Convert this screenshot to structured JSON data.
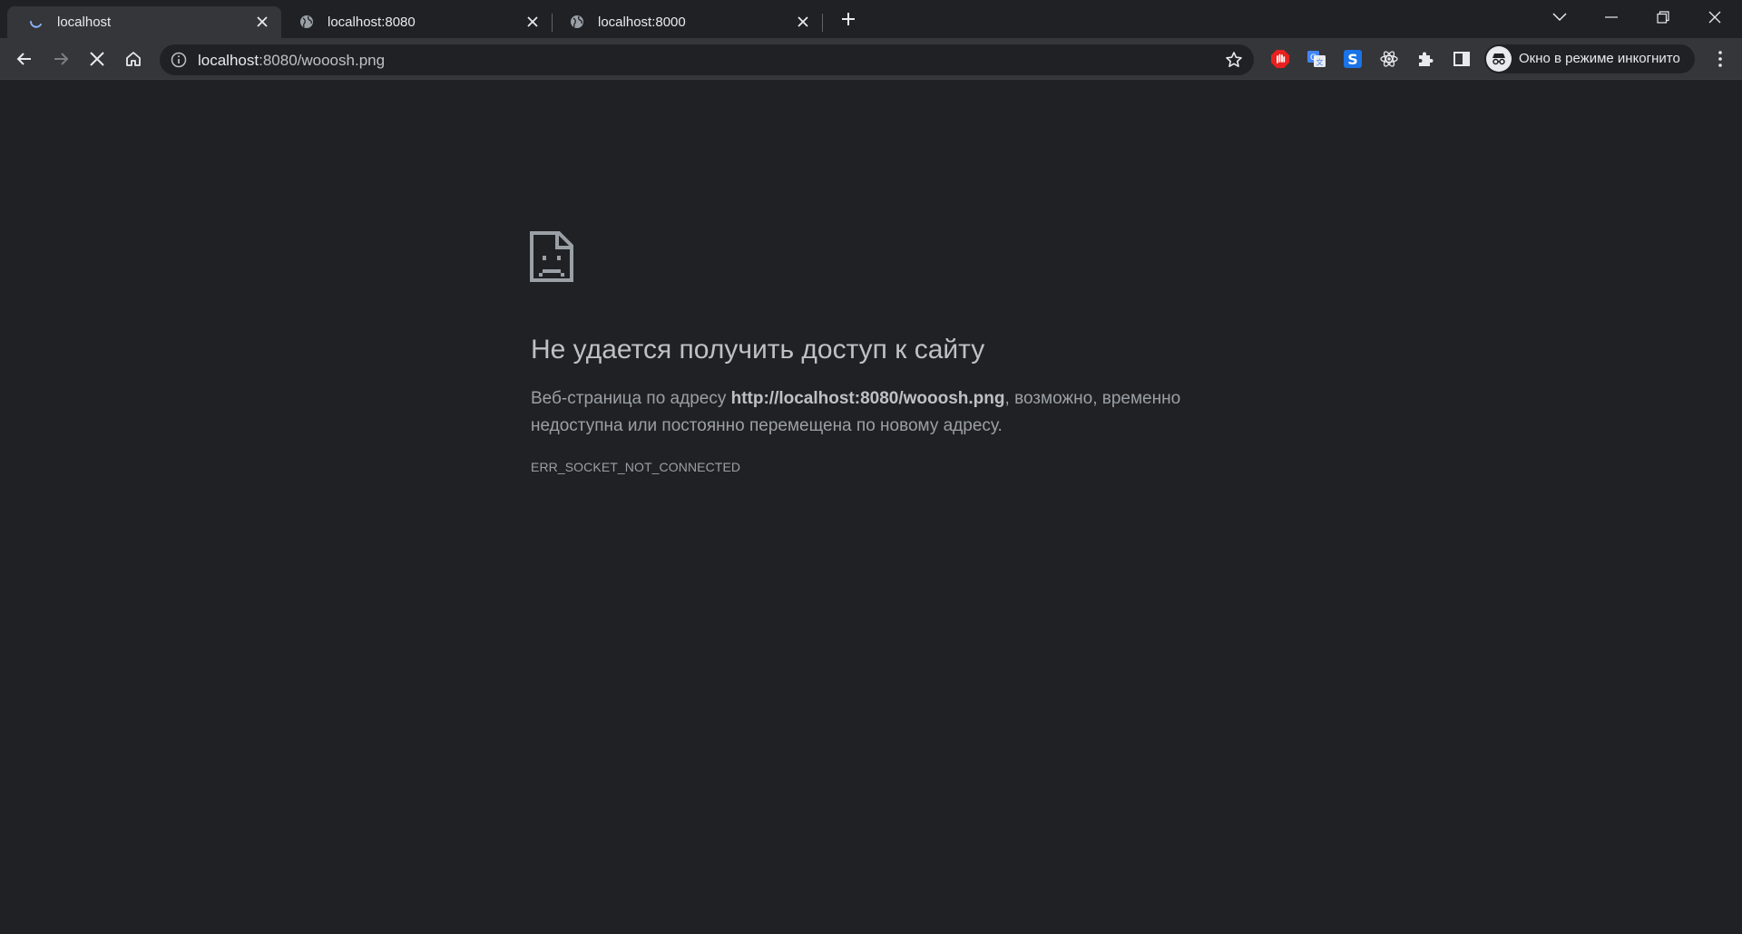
{
  "tabs": [
    {
      "title": "localhost",
      "state": "loading",
      "active": true
    },
    {
      "title": "localhost:8080",
      "state": "globe",
      "active": false
    },
    {
      "title": "localhost:8000",
      "state": "globe",
      "active": false
    }
  ],
  "toolbar": {
    "url_host": "localhost",
    "url_path": ":8080/wooosh.png",
    "profile_label": "Окно в режиме инкогнито"
  },
  "icons": {
    "back": "arrow-left-icon",
    "forward": "arrow-right-icon",
    "stop": "stop-icon",
    "home": "home-icon",
    "bookmark": "star-icon",
    "menu": "kebab-menu-icon"
  },
  "extensions": [
    "adblock-icon",
    "google-translate-icon",
    "s-extension-icon",
    "react-devtools-icon",
    "puzzle-icon",
    "side-panel-icon"
  ],
  "error_page": {
    "title": "Не удается получить доступ к сайту",
    "body_prefix": "Веб-страница по адресу ",
    "body_url": "http://localhost:8080/wooosh.png",
    "body_suffix": ", возможно, временно недоступна или постоянно перемещена по новому адресу.",
    "code": "ERR_SOCKET_NOT_CONNECTED"
  },
  "colors": {
    "background": "#202124",
    "toolbar": "#35363a",
    "text_primary": "#bdc1c6",
    "text_secondary": "#9aa0a6"
  }
}
